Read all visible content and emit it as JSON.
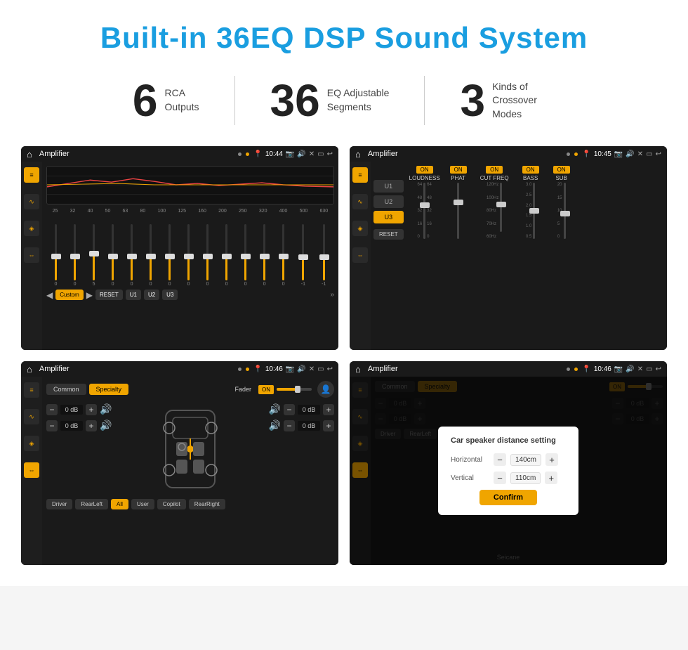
{
  "header": {
    "title": "Built-in 36EQ DSP Sound System"
  },
  "stats": [
    {
      "number": "6",
      "label": "RCA\nOutputs"
    },
    {
      "number": "36",
      "label": "EQ Adjustable\nSegments"
    },
    {
      "number": "3",
      "label": "Kinds of\nCrossover Modes"
    }
  ],
  "screens": {
    "screen1": {
      "status_bar": {
        "title": "Amplifier",
        "time": "10:44"
      },
      "freq_labels": [
        "25",
        "32",
        "40",
        "50",
        "63",
        "80",
        "100",
        "125",
        "160",
        "200",
        "250",
        "320",
        "400",
        "500",
        "630"
      ],
      "bottom_buttons": [
        "Custom",
        "RESET",
        "U1",
        "U2",
        "U3"
      ]
    },
    "screen2": {
      "status_bar": {
        "title": "Amplifier",
        "time": "10:45"
      },
      "u_buttons": [
        "U1",
        "U2",
        "U3"
      ],
      "cols": [
        {
          "label": "LOUDNESS",
          "on": true
        },
        {
          "label": "PHAT",
          "on": true
        },
        {
          "label": "CUT FREQ",
          "on": true
        },
        {
          "label": "BASS",
          "on": true
        },
        {
          "label": "SUB",
          "on": true
        }
      ],
      "reset_label": "RESET"
    },
    "screen3": {
      "status_bar": {
        "title": "Amplifier",
        "time": "10:46"
      },
      "tabs": [
        "Common",
        "Specialty"
      ],
      "fader_label": "Fader",
      "on_label": "ON",
      "channels": [
        {
          "val": "0 dB"
        },
        {
          "val": "0 dB"
        },
        {
          "val": "0 dB"
        },
        {
          "val": "0 dB"
        }
      ],
      "bottom_buttons": [
        "Driver",
        "RearLeft",
        "All",
        "User",
        "Copilot",
        "RearRight"
      ]
    },
    "screen4": {
      "status_bar": {
        "title": "Amplifier",
        "time": "10:46"
      },
      "tabs": [
        "Common",
        "Specialty"
      ],
      "on_label": "ON",
      "dialog": {
        "title": "Car speaker distance setting",
        "rows": [
          {
            "label": "Horizontal",
            "value": "140cm"
          },
          {
            "label": "Vertical",
            "value": "110cm"
          }
        ],
        "confirm_label": "Confirm"
      },
      "right_channels": [
        "0 dB",
        "0 dB"
      ],
      "bottom_buttons": [
        "Driver",
        "RearLeft",
        "All",
        "User",
        "Copilot",
        "RearRight"
      ]
    }
  }
}
